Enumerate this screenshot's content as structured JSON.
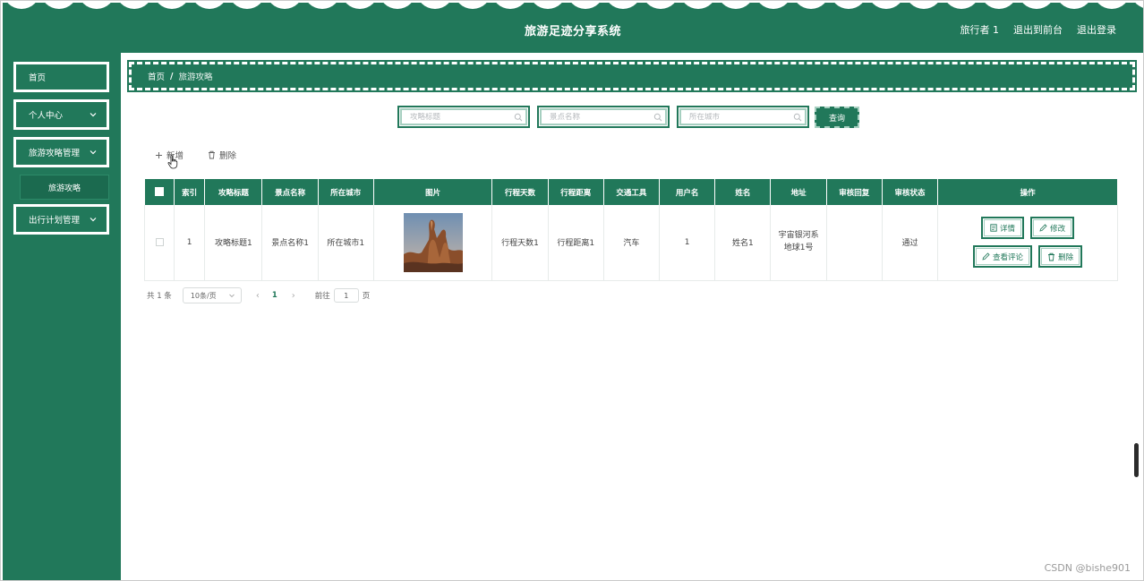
{
  "header": {
    "title": "旅游足迹分享系统",
    "user": "旅行者 1",
    "to_front": "退出到前台",
    "logout": "退出登录"
  },
  "sidebar": {
    "items": [
      {
        "label": "首页"
      },
      {
        "label": "个人中心"
      },
      {
        "label": "旅游攻略管理"
      },
      {
        "label": "出行计划管理"
      }
    ],
    "sub_item": "旅游攻略"
  },
  "breadcrumb": {
    "home": "首页",
    "separator": "/",
    "current": "旅游攻略"
  },
  "search": {
    "title_placeholder": "攻略标题",
    "scenic_placeholder": "景点名称",
    "city_placeholder": "所在城市",
    "query_label": "查询"
  },
  "toolbar": {
    "add_label": "新增",
    "delete_label": "删除"
  },
  "table": {
    "columns": [
      "索引",
      "攻略标题",
      "景点名称",
      "所在城市",
      "图片",
      "行程天数",
      "行程距离",
      "交通工具",
      "用户名",
      "姓名",
      "地址",
      "审核回复",
      "审核状态",
      "操作"
    ],
    "rows": [
      {
        "index": "1",
        "title": "攻略标题1",
        "scenic": "景点名称1",
        "city": "所在城市1",
        "days": "行程天数1",
        "distance": "行程距离1",
        "transport": "汽车",
        "username": "1",
        "name": "姓名1",
        "address": "宇宙银河系地球1号",
        "reply": "",
        "status": "通过"
      }
    ],
    "actions": {
      "detail": "详情",
      "edit": "修改",
      "comments": "查看评论",
      "delete": "删除"
    }
  },
  "pagination": {
    "total": "共 1 条",
    "page_size": "10条/页",
    "current_page": "1",
    "goto_label": "前往",
    "goto_value": "1",
    "page_suffix": "页"
  },
  "watermark": "CSDN @bishe901",
  "colors": {
    "primary": "#21785a",
    "accent_light": "#a6cfc0"
  }
}
